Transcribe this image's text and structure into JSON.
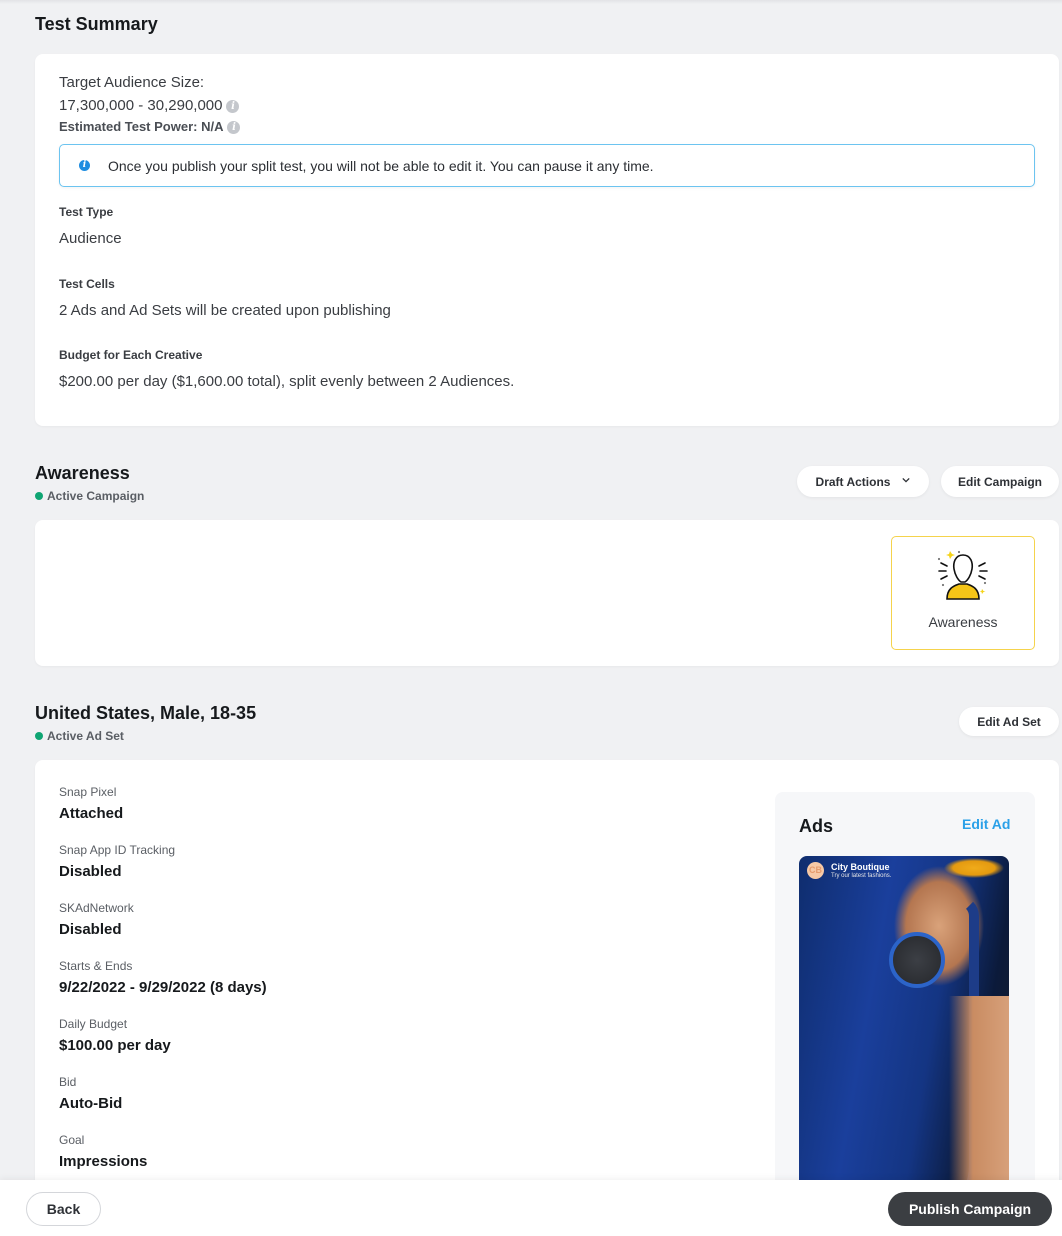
{
  "test_summary": {
    "title": "Test Summary",
    "audience_size_label": "Target Audience Size:",
    "audience_size_value": "17,300,000 - 30,290,000",
    "test_power": "Estimated Test Power: N/A",
    "info_glyph": "i",
    "notice": "Once you publish your split test, you will not be able to edit it. You can pause it any time.",
    "fields": [
      {
        "label": "Test Type",
        "value": "Audience"
      },
      {
        "label": "Test Cells",
        "value": "2 Ads and Ad Sets will be created upon publishing"
      },
      {
        "label": "Budget for Each Creative",
        "value": "$200.00 per day ($1,600.00 total), split evenly between 2 Audiences."
      }
    ]
  },
  "campaign": {
    "title": "Awareness",
    "status": "Active Campaign",
    "status_color": "#0fa573",
    "draft_actions_label": "Draft Actions",
    "edit_campaign_label": "Edit Campaign",
    "objective_tile_label": "Awareness",
    "objective_icon": "awareness-person-icon"
  },
  "ad_set": {
    "title": "United States, Male, 18-35",
    "status": "Active Ad Set",
    "edit_ad_set_label": "Edit Ad Set",
    "fields": [
      {
        "label": "Snap Pixel",
        "value": "Attached"
      },
      {
        "label": "Snap App ID Tracking",
        "value": "Disabled"
      },
      {
        "label": "SKAdNetwork",
        "value": "Disabled"
      },
      {
        "label": "Starts & Ends",
        "value": "9/22/2022 - 9/29/2022 (8 days)"
      },
      {
        "label": "Daily Budget",
        "value": "$100.00 per day"
      },
      {
        "label": "Bid",
        "value": "Auto-Bid"
      },
      {
        "label": "Goal",
        "value": "Impressions"
      }
    ]
  },
  "ads": {
    "title": "Ads",
    "edit_ad_label": "Edit Ad",
    "edit_ad_color": "#2aa0e8",
    "preview": {
      "brand_name": "City Boutique",
      "brand_tagline": "Try our latest fashions.",
      "logo_text": "CB"
    }
  },
  "footer": {
    "back_label": "Back",
    "publish_label": "Publish Campaign"
  }
}
